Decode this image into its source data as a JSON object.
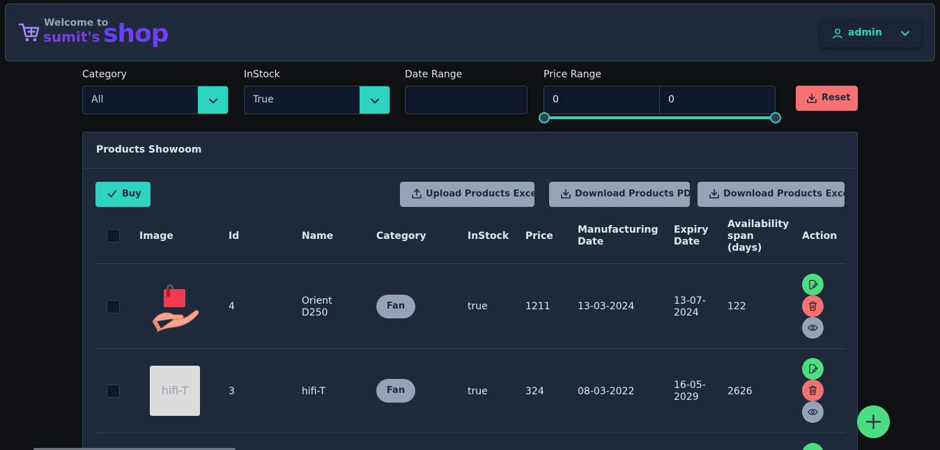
{
  "header": {
    "welcome": "Welcome to",
    "brand": "sumit's",
    "brand_word": "shop",
    "user": "admin",
    "icons": {
      "cart": "cart-plus-icon",
      "user": "user-icon",
      "caret": "chevron-down-icon"
    }
  },
  "filters": {
    "category_label": "Category",
    "category_value": "All",
    "instock_label": "InStock",
    "instock_value": "True",
    "date_label": "Date Range",
    "date_value": "",
    "price_label": "Price Range",
    "price_min": "0",
    "price_max": "0",
    "reset_label": "Reset"
  },
  "panel": {
    "title": "Products Showoom",
    "buy_label": "Buy",
    "upload_label": "Upload Products Excel",
    "download_pdf_label": "Download Products PDF",
    "download_excel_label": "Download Products Excel"
  },
  "table": {
    "headers": {
      "image": "Image",
      "id": "Id",
      "name": "Name",
      "category": "Category",
      "instock": "InStock",
      "price": "Price",
      "mfg": [
        "Manufacturing",
        "Date"
      ],
      "expiry": [
        "Expiry",
        "Date"
      ],
      "span": [
        "Availability",
        "span",
        "(days)"
      ],
      "action": "Action"
    },
    "rows": [
      {
        "id": "4",
        "name": [
          "Orient",
          "D250"
        ],
        "category": "Fan",
        "instock": "true",
        "price": "1211",
        "mfg": "13-03-2024",
        "expiry": [
          "13-07-",
          "2024"
        ],
        "span": "122",
        "image": "hand-bag-icon"
      },
      {
        "id": "3",
        "name": [
          "hifi-T"
        ],
        "category": "Fan",
        "instock": "true",
        "price": "324",
        "mfg": "08-03-2022",
        "expiry": [
          "16-05-",
          "2029"
        ],
        "span": "2626",
        "image_text": "hifi-T"
      }
    ]
  },
  "colors": {
    "accent": "#2dd4bf",
    "brand": "#6d3ff2",
    "danger": "#f87171",
    "success": "#4ade80",
    "muted": "#94a3b8",
    "surface": "#1e293b"
  }
}
